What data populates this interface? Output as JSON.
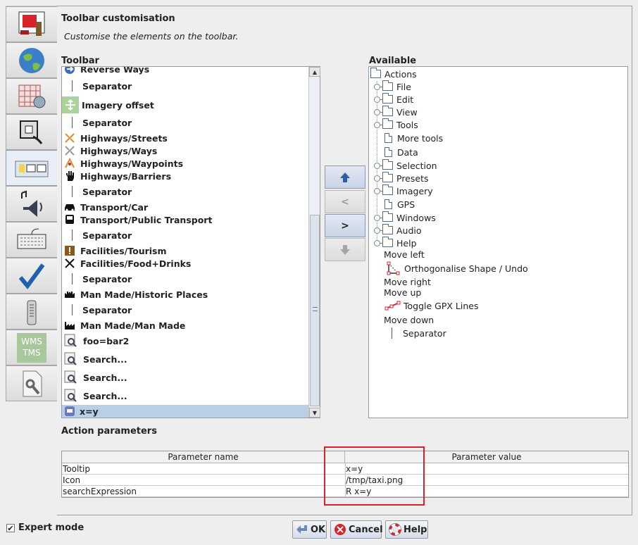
{
  "tabs": [
    {
      "icon": "display-settings-icon"
    },
    {
      "icon": "globe-icon"
    },
    {
      "icon": "map-projection-icon"
    },
    {
      "icon": "plugin-icon"
    },
    {
      "icon": "toolbar-icon",
      "active": true
    },
    {
      "icon": "audio-icon"
    },
    {
      "icon": "keyboard-icon"
    },
    {
      "icon": "validator-checkmark-icon"
    },
    {
      "icon": "remote-control-icon"
    },
    {
      "icon": "wms-tms-icon",
      "label_line1": "WMS",
      "label_line2": "TMS"
    },
    {
      "icon": "advanced-preferences-icon"
    }
  ],
  "page": {
    "title": "Toolbar customisation",
    "subtitle": "Customise the elements on the toolbar."
  },
  "toolbar": {
    "heading": "Toolbar",
    "items": [
      {
        "label": "Reverse Ways",
        "icon": "reverse-ways-icon"
      },
      {
        "label": "Separator",
        "icon": "separator"
      },
      {
        "label": "Imagery offset",
        "icon": "imagery-offset-icon"
      },
      {
        "label": "Separator",
        "icon": "separator"
      },
      {
        "label": "Highways/Streets",
        "icon": "highway-streets-icon"
      },
      {
        "label": "Highways/Ways",
        "icon": "highway-ways-icon"
      },
      {
        "label": "Highways/Waypoints",
        "icon": "highway-waypoints-icon"
      },
      {
        "label": "Highways/Barriers",
        "icon": "barrier-hand-icon"
      },
      {
        "label": "Separator",
        "icon": "separator"
      },
      {
        "label": "Transport/Car",
        "icon": "car-icon"
      },
      {
        "label": "Transport/Public Transport",
        "icon": "bus-icon"
      },
      {
        "label": "Separator",
        "icon": "separator"
      },
      {
        "label": "Facilities/Tourism",
        "icon": "tourism-icon"
      },
      {
        "label": "Facilities/Food+Drinks",
        "icon": "food-drinks-icon"
      },
      {
        "label": "Separator",
        "icon": "separator"
      },
      {
        "label": "Man Made/Historic Places",
        "icon": "historic-places-icon"
      },
      {
        "label": "Separator",
        "icon": "separator"
      },
      {
        "label": "Man Made/Man Made",
        "icon": "factory-icon"
      },
      {
        "label": "foo=bar2",
        "icon": "search-icon"
      },
      {
        "label": "Search...",
        "icon": "search-icon"
      },
      {
        "label": "Search...",
        "icon": "search-icon"
      },
      {
        "label": "Search...",
        "icon": "search-icon"
      },
      {
        "label": "x=y",
        "icon": "taxi-icon",
        "selected": true
      }
    ]
  },
  "move_buttons": {
    "up": "up-arrow-icon",
    "left": "<",
    "right": ">",
    "down": "down-arrow-icon"
  },
  "available": {
    "heading": "Available",
    "nodes": [
      {
        "label": "Actions",
        "kind": "folder",
        "depth": 0
      },
      {
        "label": "File",
        "kind": "folder",
        "depth": 1
      },
      {
        "label": "Edit",
        "kind": "folder",
        "depth": 1
      },
      {
        "label": "View",
        "kind": "folder",
        "depth": 1
      },
      {
        "label": "Tools",
        "kind": "folder",
        "depth": 1
      },
      {
        "label": "More tools",
        "kind": "doc",
        "depth": 1
      },
      {
        "label": "Data",
        "kind": "doc",
        "depth": 1
      },
      {
        "label": "Selection",
        "kind": "folder",
        "depth": 1
      },
      {
        "label": "Presets",
        "kind": "folder",
        "depth": 1
      },
      {
        "label": "Imagery",
        "kind": "folder",
        "depth": 1
      },
      {
        "label": "GPS",
        "kind": "doc",
        "depth": 1
      },
      {
        "label": "Windows",
        "kind": "folder",
        "depth": 1
      },
      {
        "label": "Audio",
        "kind": "folder",
        "depth": 1
      },
      {
        "label": "Help",
        "kind": "folder",
        "depth": 1
      },
      {
        "label": "Move left",
        "kind": "text",
        "depth": 1
      },
      {
        "label": "Orthogonalise Shape / Undo",
        "kind": "ortho",
        "depth": 2
      },
      {
        "label": "Move right",
        "kind": "text",
        "depth": 1
      },
      {
        "label": "Move up",
        "kind": "text",
        "depth": 1
      },
      {
        "label": "Toggle GPX Lines",
        "kind": "gpx",
        "depth": 2
      },
      {
        "label": "Move down",
        "kind": "text",
        "depth": 1
      },
      {
        "label": "Separator",
        "kind": "separator",
        "depth": 2
      }
    ]
  },
  "params": {
    "heading": "Action parameters",
    "col_name": "Parameter name",
    "col_value": "Parameter value",
    "rows": [
      {
        "name": "Tooltip",
        "value": "x=y"
      },
      {
        "name": "Icon",
        "value": "/tmp/taxi.png"
      },
      {
        "name": "searchExpression",
        "value": "R x=y"
      }
    ]
  },
  "footer": {
    "expert_mode": "Expert mode",
    "expert_checked": "✔",
    "ok": "OK",
    "cancel": "Cancel",
    "help": "Help"
  }
}
